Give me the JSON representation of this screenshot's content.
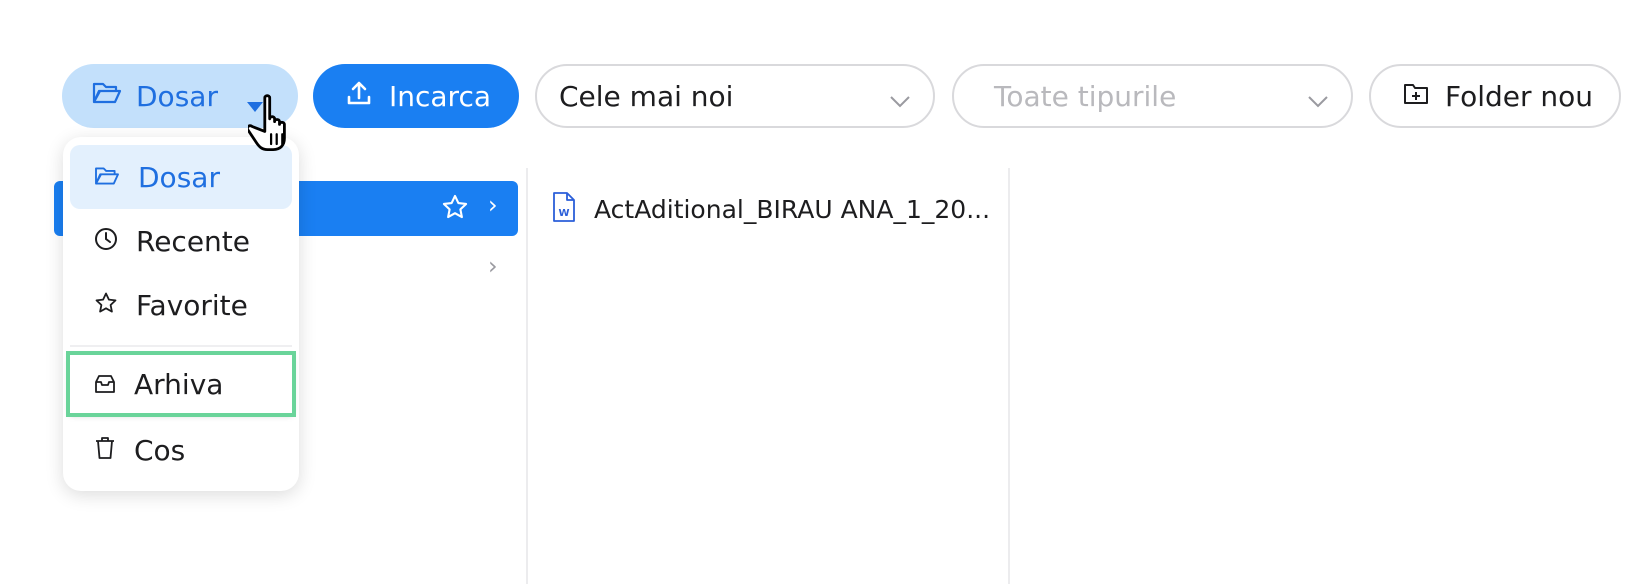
{
  "toolbar": {
    "dosar_label": "Dosar",
    "upload_label": "Incarca",
    "sort_value": "Cele mai noi",
    "type_placeholder": "Toate tipurile",
    "new_folder_label": "Folder nou"
  },
  "menu": {
    "items": [
      {
        "label": "Dosar",
        "icon": "folder-open-icon"
      },
      {
        "label": "Recente",
        "icon": "clock-icon"
      },
      {
        "label": "Favorite",
        "icon": "star-icon"
      },
      {
        "label": "Arhiva",
        "icon": "archive-icon"
      },
      {
        "label": "Cos",
        "icon": "trash-icon"
      }
    ]
  },
  "files": [
    {
      "name": "ActAditional_BIRAU ANA_1_20...",
      "icon": "word-document-icon"
    }
  ],
  "colors": {
    "accent": "#1a7ff2",
    "accent_light": "#c3e0fb",
    "highlight_outline": "#6ad49a"
  }
}
